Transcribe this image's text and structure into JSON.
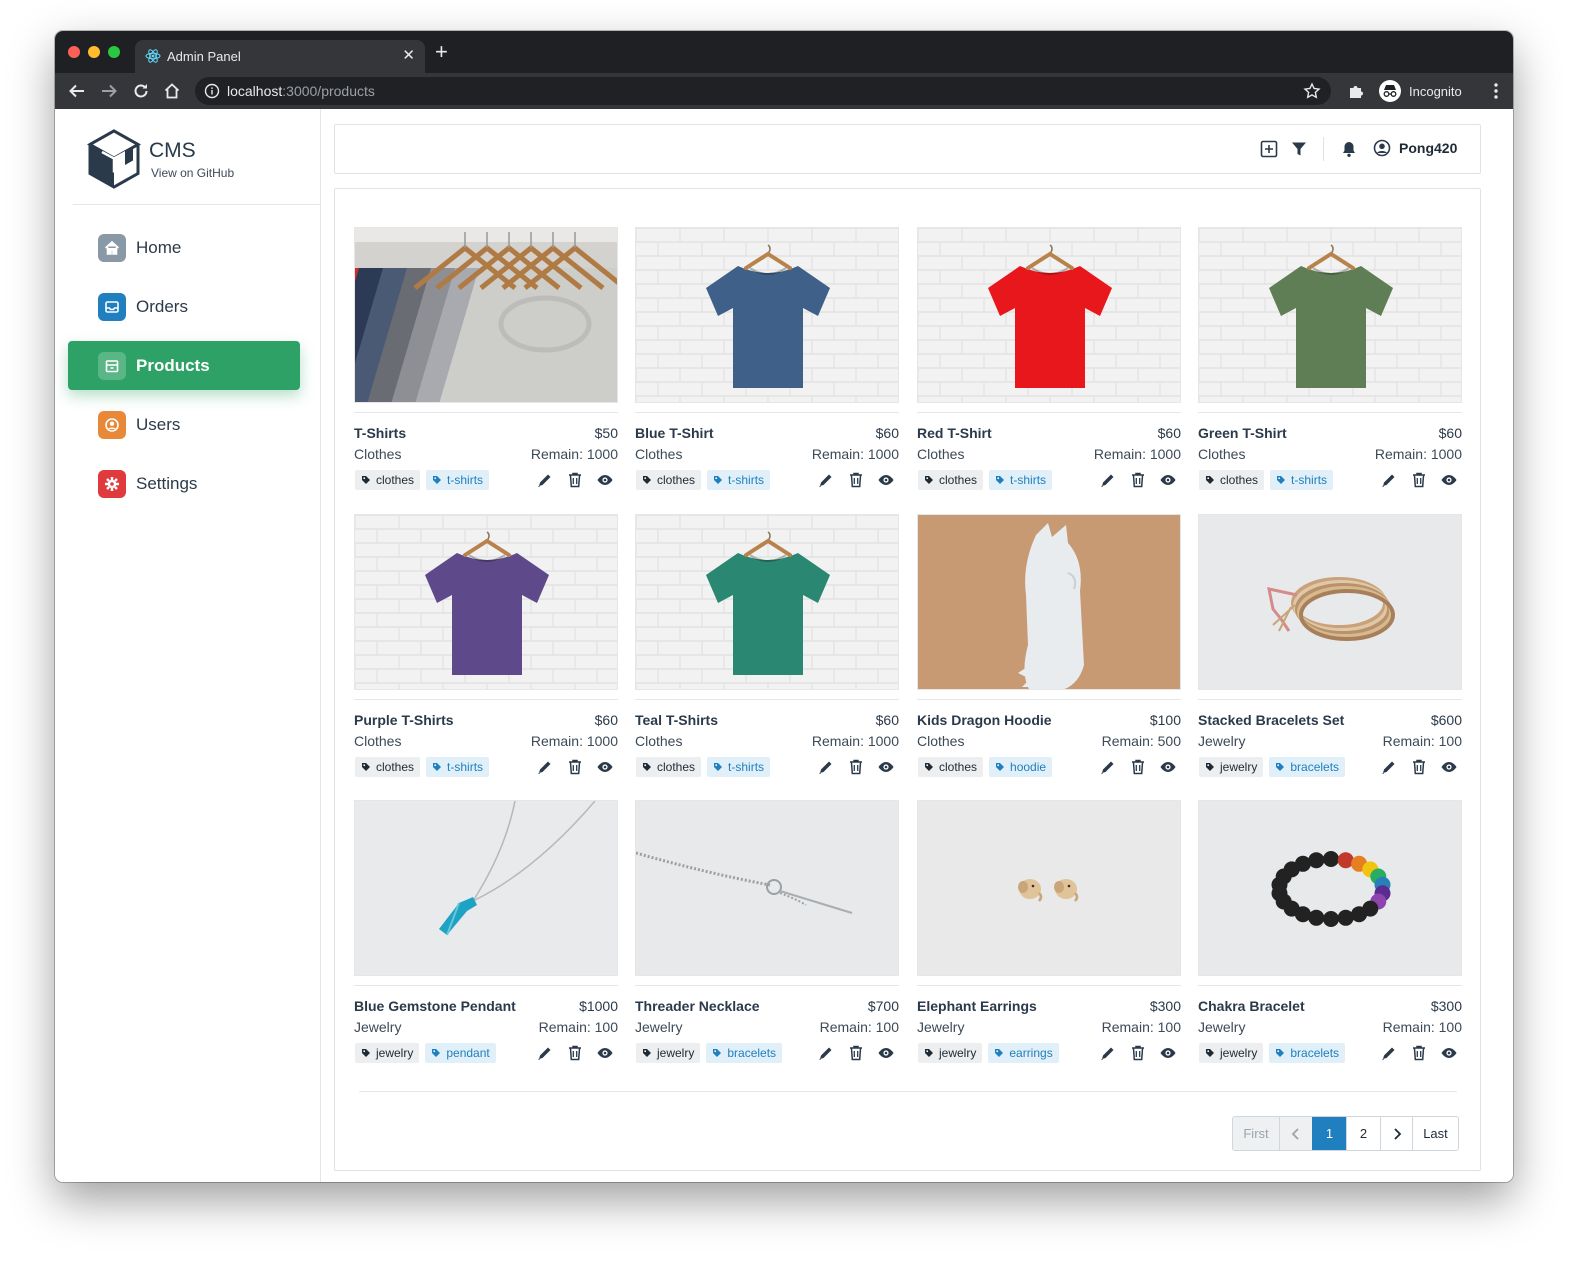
{
  "browser": {
    "tab_title": "Admin Panel",
    "url_host": "localhost",
    "url_path": ":3000/products",
    "profile_label": "Incognito"
  },
  "brand": {
    "title": "CMS",
    "link": "View on GitHub"
  },
  "sidebar": {
    "items": [
      {
        "label": "Home",
        "icon": "home-icon",
        "color": "#8a99a6"
      },
      {
        "label": "Orders",
        "icon": "inbox-icon",
        "color": "#1f7fbf"
      },
      {
        "label": "Products",
        "icon": "products-icon",
        "color": "#2ea266",
        "active": true
      },
      {
        "label": "Users",
        "icon": "user-icon",
        "color": "#e8893a"
      },
      {
        "label": "Settings",
        "icon": "gear-icon",
        "color": "#e03a3e"
      }
    ]
  },
  "topbar": {
    "user_name": "Pong420"
  },
  "products": [
    {
      "name": "T-Shirts",
      "price": "$50",
      "category": "Clothes",
      "remain": "Remain: 1000",
      "tags": [
        "clothes",
        "t-shirts"
      ],
      "image": "hangers"
    },
    {
      "name": "Blue T-Shirt",
      "price": "$60",
      "category": "Clothes",
      "remain": "Remain: 1000",
      "tags": [
        "clothes",
        "t-shirts"
      ],
      "image": "tshirt",
      "color": "#3f6189"
    },
    {
      "name": "Red T-Shirt",
      "price": "$60",
      "category": "Clothes",
      "remain": "Remain: 1000",
      "tags": [
        "clothes",
        "t-shirts"
      ],
      "image": "tshirt",
      "color": "#e8171c"
    },
    {
      "name": "Green T-Shirt",
      "price": "$60",
      "category": "Clothes",
      "remain": "Remain: 1000",
      "tags": [
        "clothes",
        "t-shirts"
      ],
      "image": "tshirt",
      "color": "#607e55"
    },
    {
      "name": "Purple T-Shirts",
      "price": "$60",
      "category": "Clothes",
      "remain": "Remain: 1000",
      "tags": [
        "clothes",
        "t-shirts"
      ],
      "image": "tshirt",
      "color": "#5e4a8b"
    },
    {
      "name": "Teal T-Shirts",
      "price": "$60",
      "category": "Clothes",
      "remain": "Remain: 1000",
      "tags": [
        "clothes",
        "t-shirts"
      ],
      "image": "tshirt",
      "color": "#2a8771"
    },
    {
      "name": "Kids Dragon Hoodie",
      "price": "$100",
      "category": "Clothes",
      "remain": "Remain: 500",
      "tags": [
        "clothes",
        "hoodie"
      ],
      "image": "hoodie"
    },
    {
      "name": "Stacked Bracelets Set",
      "price": "$600",
      "category": "Jewelry",
      "remain": "Remain: 100",
      "tags": [
        "jewelry",
        "bracelets"
      ],
      "image": "bracelets"
    },
    {
      "name": "Blue Gemstone Pendant",
      "price": "$1000",
      "category": "Jewelry",
      "remain": "Remain: 100",
      "tags": [
        "jewelry",
        "pendant"
      ],
      "image": "pendant"
    },
    {
      "name": "Threader Necklace",
      "price": "$700",
      "category": "Jewelry",
      "remain": "Remain: 100",
      "tags": [
        "jewelry",
        "bracelets"
      ],
      "image": "necklace"
    },
    {
      "name": "Elephant Earrings",
      "price": "$300",
      "category": "Jewelry",
      "remain": "Remain: 100",
      "tags": [
        "jewelry",
        "earrings"
      ],
      "image": "earrings"
    },
    {
      "name": "Chakra Bracelet",
      "price": "$300",
      "category": "Jewelry",
      "remain": "Remain: 100",
      "tags": [
        "jewelry",
        "bracelets"
      ],
      "image": "chakra"
    }
  ],
  "pagination": {
    "first": "First",
    "last": "Last",
    "pages": [
      "1",
      "2"
    ],
    "current": "1"
  }
}
